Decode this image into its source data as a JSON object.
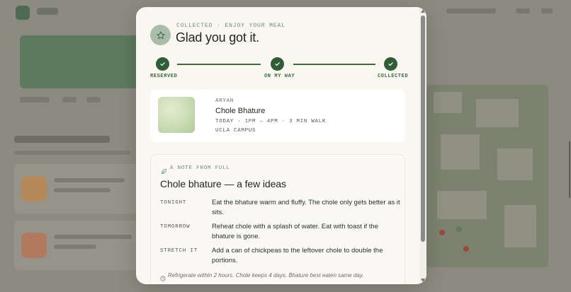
{
  "modal": {
    "eyebrow": "COLLECTED · ENJOY YOUR MEAL",
    "title": "Glad you got it.",
    "header_icon": "star-icon"
  },
  "progress": {
    "steps": [
      {
        "label": "RESERVED",
        "done": true
      },
      {
        "label": "ON MY WAY",
        "done": true
      },
      {
        "label": "COLLECTED",
        "done": true
      }
    ],
    "completed": 3,
    "total": 3
  },
  "order": {
    "vendor": "ARYAN",
    "dish": "Chole Bhature",
    "meta": "TODAY · 1PM – 4PM · 3 MIN WALK",
    "place": "UCLA CAMPUS"
  },
  "note": {
    "eyebrow": "A NOTE FROM FULL",
    "eyebrow_icon": "leaf-icon",
    "title": "Chole bhature — a few ideas",
    "tips": [
      {
        "key": "TONIGHT",
        "text": "Eat the bhature warm and fluffy. The chole only gets better as it sits."
      },
      {
        "key": "TOMORROW",
        "text": "Reheat chole with a splash of water. Eat with toast if the bhature is gone."
      },
      {
        "key": "STRETCH IT",
        "text": "Add a can of chickpeas to the leftover chole to double the portions."
      }
    ],
    "storage_icon": "clock-icon",
    "storage": "Refrigerate within 2 hours. Chole keeps 4 days. Bhature best eaten same day."
  },
  "colors": {
    "accent": "#2f5d35",
    "accent_text": "#6f8f6b",
    "modal_bg": "#faf7f1",
    "backdrop": "#8c8a80"
  }
}
